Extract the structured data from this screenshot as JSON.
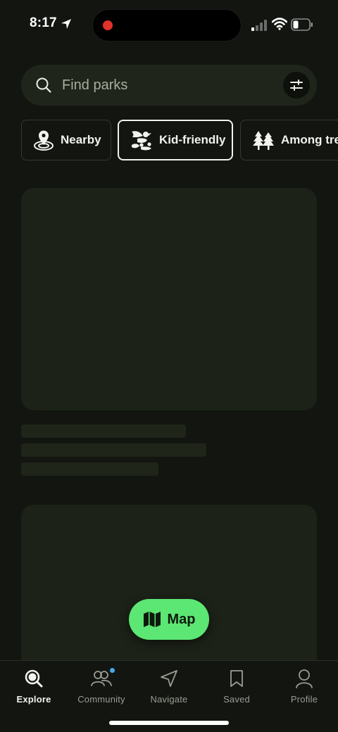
{
  "status_bar": {
    "time": "8:17",
    "icons": [
      "location-arrow-icon",
      "recording-dot-icon",
      "signal-icon",
      "wifi-icon",
      "battery-icon"
    ]
  },
  "search": {
    "placeholder": "Find parks",
    "icon": "search-icon",
    "filter_icon": "sliders-icon"
  },
  "chips": [
    {
      "label": "Nearby",
      "icon": "location-pin-icon",
      "selected": false
    },
    {
      "label": "Kid-friendly",
      "icon": "ducks-icon",
      "selected": true
    },
    {
      "label": "Among trees",
      "icon": "trees-icon",
      "selected": false
    }
  ],
  "content": {
    "state": "loading-skeleton"
  },
  "map_button": {
    "label": "Map",
    "icon": "map-icon"
  },
  "tabs": [
    {
      "label": "Explore",
      "icon": "search-icon",
      "active": true
    },
    {
      "label": "Community",
      "icon": "people-icon",
      "active": false,
      "badge": true
    },
    {
      "label": "Navigate",
      "icon": "navigate-arrow-icon",
      "active": false
    },
    {
      "label": "Saved",
      "icon": "bookmark-icon",
      "active": false
    },
    {
      "label": "Profile",
      "icon": "person-icon",
      "active": false
    }
  ],
  "colors": {
    "background": "#121510",
    "surface": "#1f251b",
    "accent": "#5ce673",
    "badge": "#47a8ec",
    "recording": "#e0322b"
  }
}
